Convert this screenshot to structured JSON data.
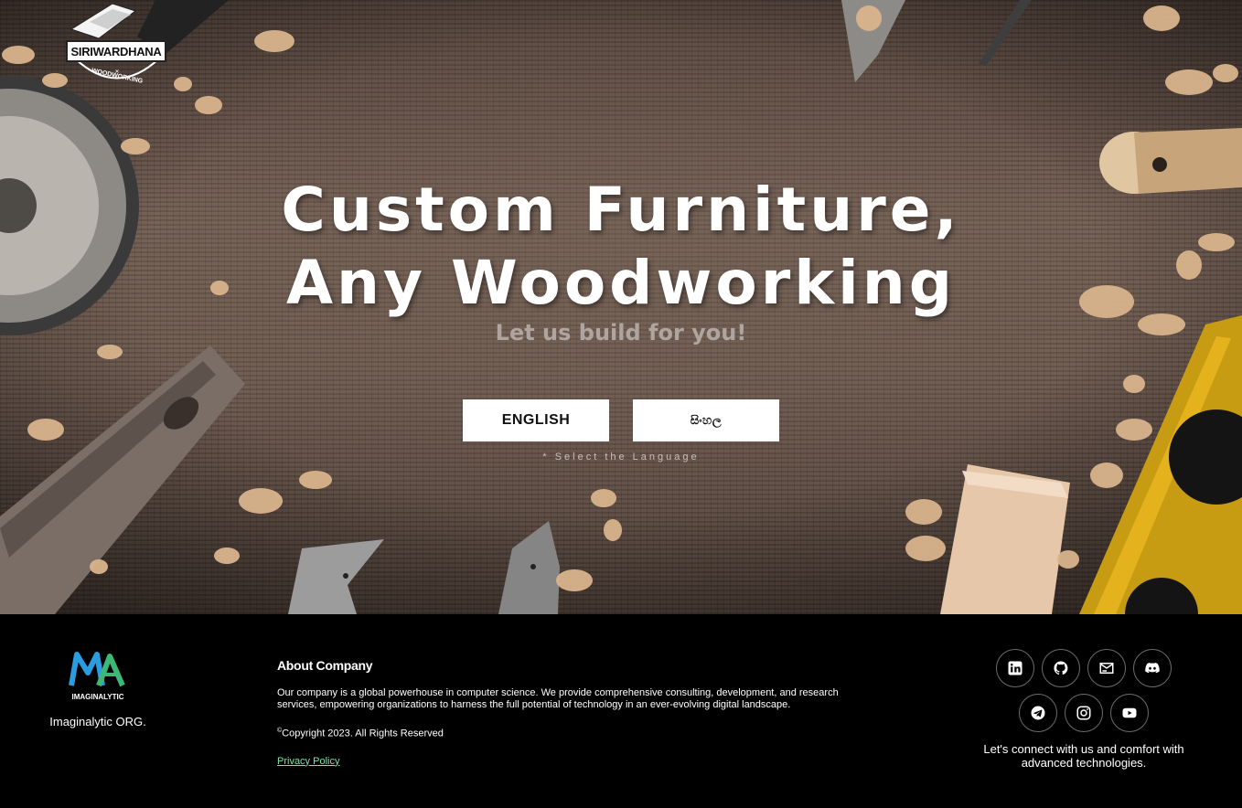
{
  "hero": {
    "logo_text": "SIRIWARDHANA",
    "logo_subtext": "WOODWORKING",
    "headline_line1": "Custom Furniture,",
    "headline_line2": "Any Woodworking",
    "tagline": "Let us build for you!",
    "language_buttons": [
      {
        "label": "ENGLISH"
      },
      {
        "label": "සිංහල"
      }
    ],
    "hint": "* Select the Language"
  },
  "footer": {
    "org_caption": "Imaginalytic ORG.",
    "org_logo_text": "IMAGINALYTIC",
    "about_title": "About Company",
    "about_text": "Our company is a global powerhouse in computer science. We provide comprehensive consulting, development, and research services, empowering organizations to harness the full potential of technology in an ever-evolving digital landscape.",
    "copyright_symbol": "©",
    "copyright": "Copyright 2023. All Rights Reserved",
    "privacy_link": "Privacy Policy",
    "social_icons": [
      "linkedin-icon",
      "github-icon",
      "mail-icon",
      "discord-icon",
      "telegram-icon",
      "instagram-icon",
      "youtube-icon"
    ],
    "connect_text": "Let's connect with us and comfort with advanced technologies."
  },
  "colors": {
    "link": "#7fe3a8",
    "footer_bg": "#000000",
    "button_bg": "#ffffff"
  }
}
